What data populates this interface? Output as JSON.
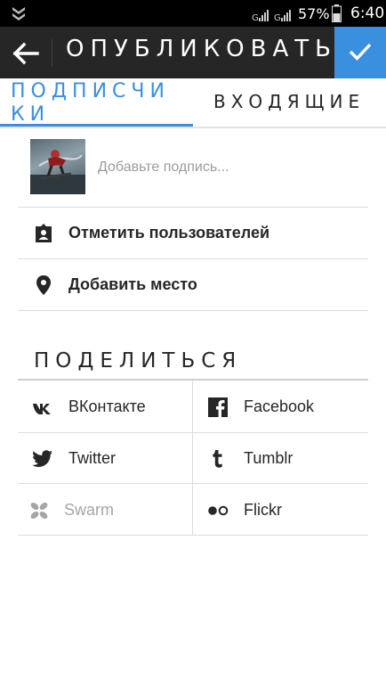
{
  "status_bar": {
    "battery_text": "57%",
    "time": "6:40",
    "signal_label": "G"
  },
  "action_bar": {
    "title": "ОПУБЛИКОВАТЬ",
    "back_icon": "arrow-left-icon",
    "confirm_icon": "checkmark-icon",
    "accent_color": "#3a8fde"
  },
  "tabs": [
    {
      "label": "ПОДПИСЧИКИ",
      "selected": true
    },
    {
      "label": "ВХОДЯЩИЕ",
      "selected": false
    }
  ],
  "caption": {
    "placeholder": "Добавьте подпись...",
    "value": ""
  },
  "options": [
    {
      "label": "Отметить пользователей",
      "icon": "tag-people-icon"
    },
    {
      "label": "Добавить место",
      "icon": "location-pin-icon"
    }
  ],
  "share": {
    "heading": "ПОДЕЛИТЬСЯ",
    "items": [
      {
        "label": "ВКонтакте",
        "icon": "vk-icon",
        "enabled": true
      },
      {
        "label": "Facebook",
        "icon": "facebook-icon",
        "enabled": true
      },
      {
        "label": "Twitter",
        "icon": "twitter-icon",
        "enabled": true
      },
      {
        "label": "Tumblr",
        "icon": "tumblr-icon",
        "enabled": true
      },
      {
        "label": "Swarm",
        "icon": "swarm-icon",
        "enabled": false
      },
      {
        "label": "Flickr",
        "icon": "flickr-icon",
        "enabled": true
      }
    ]
  }
}
